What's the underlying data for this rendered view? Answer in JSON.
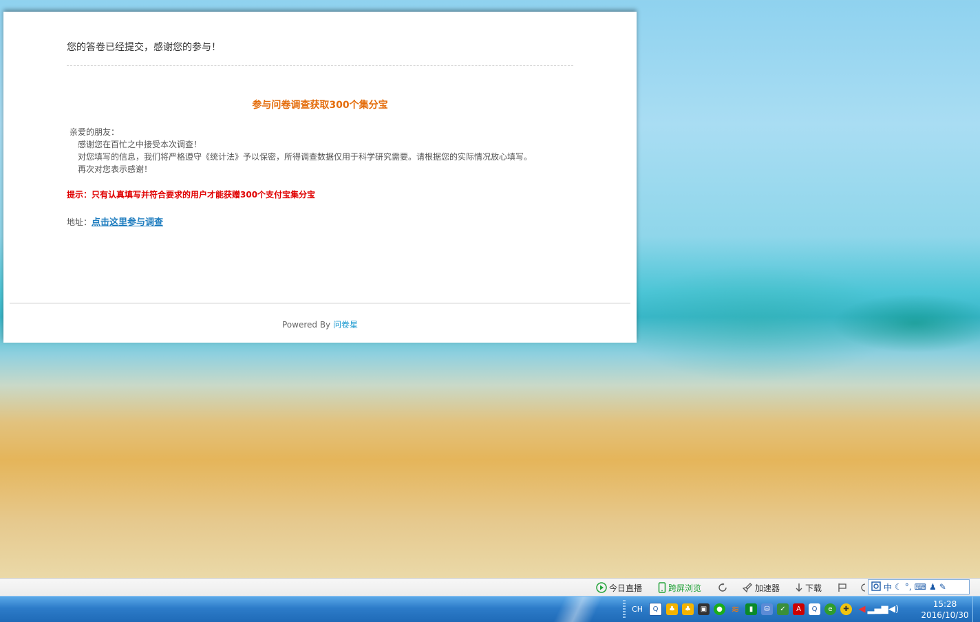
{
  "page": {
    "submitted_message": "您的答卷已经提交，感谢您的参与！",
    "survey_title": "参与问卷调查获取300个集分宝",
    "greeting": "亲爱的朋友：",
    "line1": "感谢您在百忙之中接受本次调查！",
    "line2": "对您填写的信息，我们将严格遵守《统计法》予以保密，所得调查数据仅用于科学研究需要。请根据您的实际情况放心填写。",
    "line3": "再次对您表示感谢！",
    "tip": "提示：只有认真填写并符合要求的用户才能获赠300个支付宝集分宝",
    "address_label": "地址：",
    "address_link": "点击这里参与调查",
    "powered_by": "Powered By",
    "brand": "问卷星"
  },
  "browser_bar": {
    "live": "今日直播",
    "cross_screen": "跨屏浏览",
    "accelerator": "加速器",
    "download": "下载"
  },
  "ime": {
    "mode": "中"
  },
  "taskbar": {
    "lang": "CH",
    "time": "15:28",
    "date": "2016/10/30"
  },
  "colors": {
    "title_orange": "#e46c0a",
    "tip_red": "#e00000",
    "link_blue": "#1f7dbf",
    "brand_blue": "#1f9bd1"
  }
}
